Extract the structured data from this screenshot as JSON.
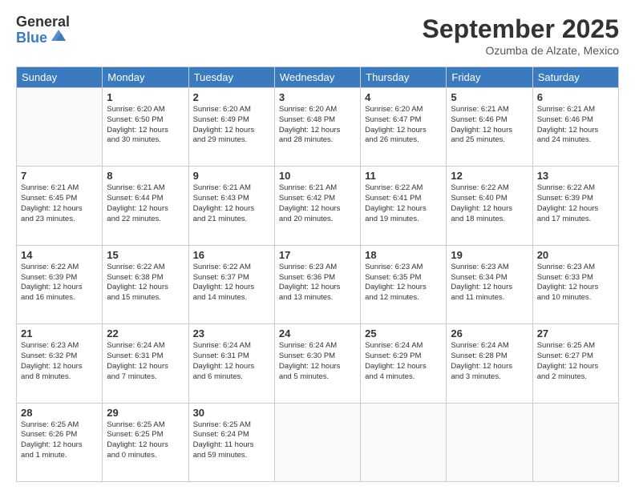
{
  "logo": {
    "general": "General",
    "blue": "Blue"
  },
  "title": {
    "month": "September 2025",
    "location": "Ozumba de Alzate, Mexico"
  },
  "weekdays": [
    "Sunday",
    "Monday",
    "Tuesday",
    "Wednesday",
    "Thursday",
    "Friday",
    "Saturday"
  ],
  "weeks": [
    [
      {
        "day": "",
        "text": ""
      },
      {
        "day": "1",
        "text": "Sunrise: 6:20 AM\nSunset: 6:50 PM\nDaylight: 12 hours\nand 30 minutes."
      },
      {
        "day": "2",
        "text": "Sunrise: 6:20 AM\nSunset: 6:49 PM\nDaylight: 12 hours\nand 29 minutes."
      },
      {
        "day": "3",
        "text": "Sunrise: 6:20 AM\nSunset: 6:48 PM\nDaylight: 12 hours\nand 28 minutes."
      },
      {
        "day": "4",
        "text": "Sunrise: 6:20 AM\nSunset: 6:47 PM\nDaylight: 12 hours\nand 26 minutes."
      },
      {
        "day": "5",
        "text": "Sunrise: 6:21 AM\nSunset: 6:46 PM\nDaylight: 12 hours\nand 25 minutes."
      },
      {
        "day": "6",
        "text": "Sunrise: 6:21 AM\nSunset: 6:46 PM\nDaylight: 12 hours\nand 24 minutes."
      }
    ],
    [
      {
        "day": "7",
        "text": "Sunrise: 6:21 AM\nSunset: 6:45 PM\nDaylight: 12 hours\nand 23 minutes."
      },
      {
        "day": "8",
        "text": "Sunrise: 6:21 AM\nSunset: 6:44 PM\nDaylight: 12 hours\nand 22 minutes."
      },
      {
        "day": "9",
        "text": "Sunrise: 6:21 AM\nSunset: 6:43 PM\nDaylight: 12 hours\nand 21 minutes."
      },
      {
        "day": "10",
        "text": "Sunrise: 6:21 AM\nSunset: 6:42 PM\nDaylight: 12 hours\nand 20 minutes."
      },
      {
        "day": "11",
        "text": "Sunrise: 6:22 AM\nSunset: 6:41 PM\nDaylight: 12 hours\nand 19 minutes."
      },
      {
        "day": "12",
        "text": "Sunrise: 6:22 AM\nSunset: 6:40 PM\nDaylight: 12 hours\nand 18 minutes."
      },
      {
        "day": "13",
        "text": "Sunrise: 6:22 AM\nSunset: 6:39 PM\nDaylight: 12 hours\nand 17 minutes."
      }
    ],
    [
      {
        "day": "14",
        "text": "Sunrise: 6:22 AM\nSunset: 6:39 PM\nDaylight: 12 hours\nand 16 minutes."
      },
      {
        "day": "15",
        "text": "Sunrise: 6:22 AM\nSunset: 6:38 PM\nDaylight: 12 hours\nand 15 minutes."
      },
      {
        "day": "16",
        "text": "Sunrise: 6:22 AM\nSunset: 6:37 PM\nDaylight: 12 hours\nand 14 minutes."
      },
      {
        "day": "17",
        "text": "Sunrise: 6:23 AM\nSunset: 6:36 PM\nDaylight: 12 hours\nand 13 minutes."
      },
      {
        "day": "18",
        "text": "Sunrise: 6:23 AM\nSunset: 6:35 PM\nDaylight: 12 hours\nand 12 minutes."
      },
      {
        "day": "19",
        "text": "Sunrise: 6:23 AM\nSunset: 6:34 PM\nDaylight: 12 hours\nand 11 minutes."
      },
      {
        "day": "20",
        "text": "Sunrise: 6:23 AM\nSunset: 6:33 PM\nDaylight: 12 hours\nand 10 minutes."
      }
    ],
    [
      {
        "day": "21",
        "text": "Sunrise: 6:23 AM\nSunset: 6:32 PM\nDaylight: 12 hours\nand 8 minutes."
      },
      {
        "day": "22",
        "text": "Sunrise: 6:24 AM\nSunset: 6:31 PM\nDaylight: 12 hours\nand 7 minutes."
      },
      {
        "day": "23",
        "text": "Sunrise: 6:24 AM\nSunset: 6:31 PM\nDaylight: 12 hours\nand 6 minutes."
      },
      {
        "day": "24",
        "text": "Sunrise: 6:24 AM\nSunset: 6:30 PM\nDaylight: 12 hours\nand 5 minutes."
      },
      {
        "day": "25",
        "text": "Sunrise: 6:24 AM\nSunset: 6:29 PM\nDaylight: 12 hours\nand 4 minutes."
      },
      {
        "day": "26",
        "text": "Sunrise: 6:24 AM\nSunset: 6:28 PM\nDaylight: 12 hours\nand 3 minutes."
      },
      {
        "day": "27",
        "text": "Sunrise: 6:25 AM\nSunset: 6:27 PM\nDaylight: 12 hours\nand 2 minutes."
      }
    ],
    [
      {
        "day": "28",
        "text": "Sunrise: 6:25 AM\nSunset: 6:26 PM\nDaylight: 12 hours\nand 1 minute."
      },
      {
        "day": "29",
        "text": "Sunrise: 6:25 AM\nSunset: 6:25 PM\nDaylight: 12 hours\nand 0 minutes."
      },
      {
        "day": "30",
        "text": "Sunrise: 6:25 AM\nSunset: 6:24 PM\nDaylight: 11 hours\nand 59 minutes."
      },
      {
        "day": "",
        "text": ""
      },
      {
        "day": "",
        "text": ""
      },
      {
        "day": "",
        "text": ""
      },
      {
        "day": "",
        "text": ""
      }
    ]
  ]
}
